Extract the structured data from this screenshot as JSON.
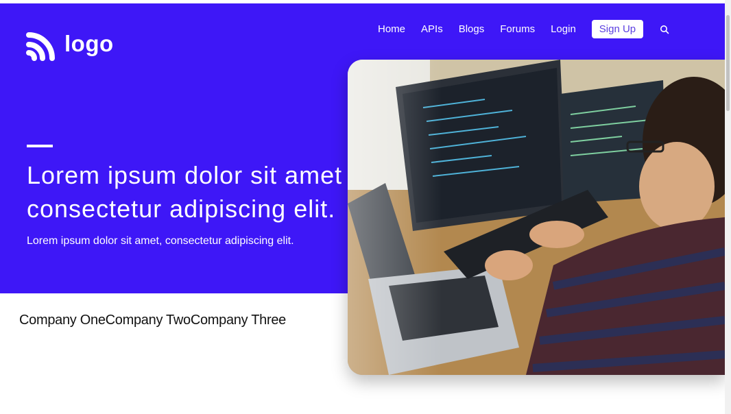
{
  "logo": {
    "text": "logo",
    "icon": "rss-feed-icon"
  },
  "nav": {
    "items": [
      "Home",
      "APIs",
      "Blogs",
      "Forums",
      "Login"
    ],
    "signup": "Sign Up",
    "search_icon": "search-icon"
  },
  "hero": {
    "headline_line1": "Lorem ipsum dolor sit amet",
    "headline_line2": "consectetur adipiscing elit.",
    "subtext": "Lorem ipsum dolor sit amet, consectetur adipiscing elit.",
    "image": "developer-working-at-computers"
  },
  "companies": [
    "Company One",
    "Company Two",
    "Company Three"
  ],
  "colors": {
    "brand": "#3e17f7",
    "signup_text": "#5b3fe0"
  }
}
